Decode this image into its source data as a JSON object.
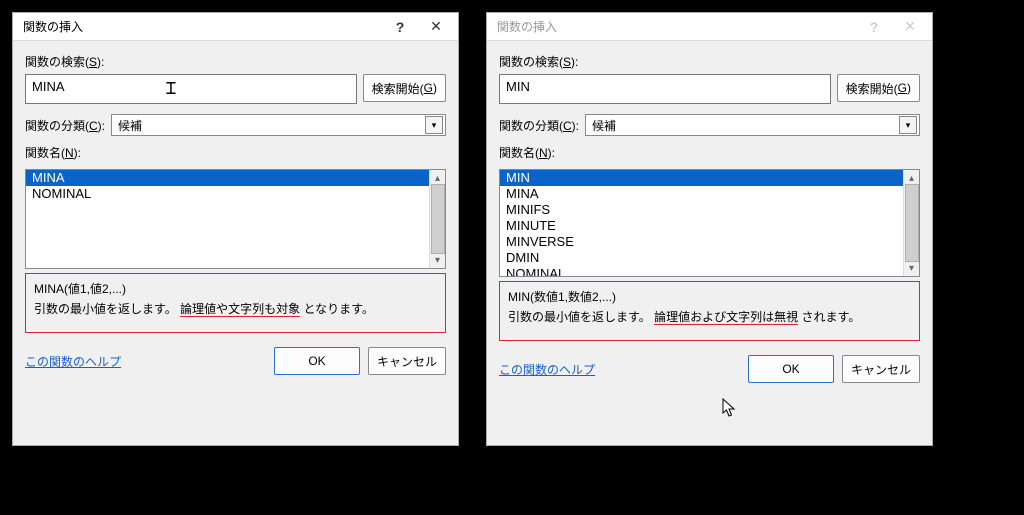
{
  "left": {
    "title": "関数の挿入",
    "search_label_pre": "関数の検索(",
    "search_label_acc": "S",
    "search_label_post": "):",
    "search_value": "MINA",
    "search_btn_pre": "検索開始(",
    "search_btn_acc": "G",
    "search_btn_post": ")",
    "cat_label_pre": "関数の分類(",
    "cat_label_acc": "C",
    "cat_label_post": "):",
    "cat_value": "候補",
    "name_label_pre": "関数名(",
    "name_label_acc": "N",
    "name_label_post": "):",
    "list": {
      "i0": "MINA",
      "i1": "NOMINAL"
    },
    "sig": "MINA(値1,値2,...)",
    "desc_pre": "引数の最小値を返します。",
    "desc_ul": "論理値や文字列も対象",
    "desc_post": "となります。",
    "help": "この関数のヘルプ",
    "ok": "OK",
    "cancel": "キャンセル"
  },
  "right": {
    "title": "関数の挿入",
    "search_label_pre": "関数の検索(",
    "search_label_acc": "S",
    "search_label_post": "):",
    "search_value": "MIN",
    "search_btn_pre": "検索開始(",
    "search_btn_acc": "G",
    "search_btn_post": ")",
    "cat_label_pre": "関数の分類(",
    "cat_label_acc": "C",
    "cat_label_post": "):",
    "cat_value": "候補",
    "name_label_pre": "関数名(",
    "name_label_acc": "N",
    "name_label_post": "):",
    "list": {
      "i0": "MIN",
      "i1": "MINA",
      "i2": "MINIFS",
      "i3": "MINUTE",
      "i4": "MINVERSE",
      "i5": "DMIN",
      "i6": "NOMINAL"
    },
    "sig": "MIN(数値1,数値2,...)",
    "desc_pre": "引数の最小値を返します。",
    "desc_ul": "論理値および文字列は無視",
    "desc_post": "されます。",
    "help": "この関数のヘルプ",
    "ok": "OK",
    "cancel": "キャンセル"
  }
}
